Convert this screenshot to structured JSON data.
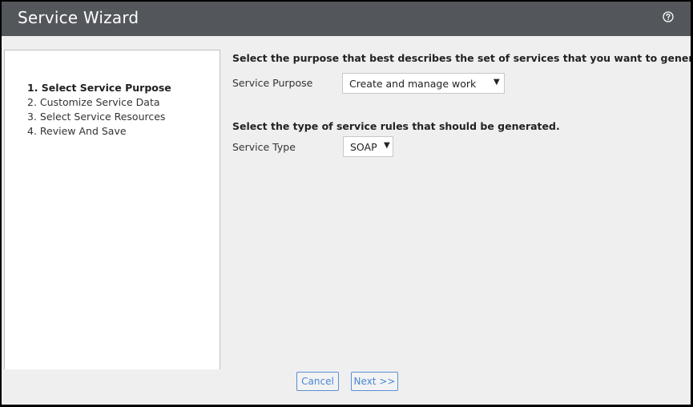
{
  "window": {
    "title": "Service Wizard",
    "help_icon": "question-circle-icon"
  },
  "steps": [
    {
      "label": "1. Select Service Purpose",
      "active": true
    },
    {
      "label": "2. Customize Service Data",
      "active": false
    },
    {
      "label": "3. Select Service Resources",
      "active": false
    },
    {
      "label": "4. Review And Save",
      "active": false
    }
  ],
  "purpose_section": {
    "heading": "Select the purpose that best describes the set of services that you want to generate.",
    "label": "Service Purpose",
    "selected": "Create and manage work",
    "caret": "▼"
  },
  "type_section": {
    "heading": "Select the type of service rules that should be generated.",
    "label": "Service Type",
    "selected": "SOAP",
    "caret": "▼"
  },
  "footer": {
    "cancel_label": "Cancel",
    "next_label": "Next >>"
  },
  "colors": {
    "header_bg": "#53575b",
    "button_accent": "#4b86d4",
    "page_bg": "#efefef"
  }
}
